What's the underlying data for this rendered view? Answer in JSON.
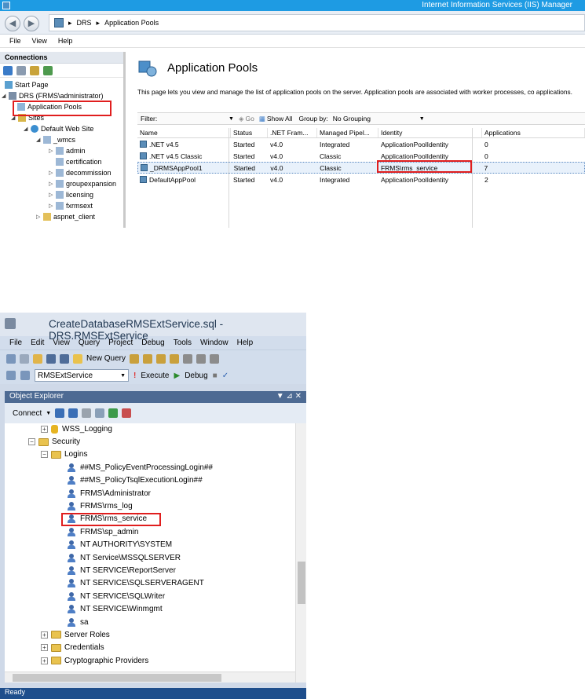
{
  "iis": {
    "window_title": "Internet Information Services (IIS) Manager",
    "breadcrumb": [
      "DRS",
      "Application Pools"
    ],
    "menu": [
      "File",
      "View",
      "Help"
    ],
    "connections_label": "Connections",
    "tree": {
      "start_page": "Start Page",
      "server": "DRS (FRMS\\administrator)",
      "app_pools": "Application Pools",
      "sites": "Sites",
      "default_site": "Default Web Site",
      "children": [
        "_wmcs",
        "admin",
        "certification",
        "decommission",
        "groupexpansion",
        "licensing",
        "fxrmsext",
        "aspnet_client"
      ]
    },
    "page_title": "Application Pools",
    "description": "This page lets you view and manage the list of application pools on the server. Application pools are associated with worker processes, co applications.",
    "filter": {
      "label": "Filter:",
      "go": "Go",
      "show_all": "Show All",
      "group_by_label": "Group by:",
      "group_by_value": "No Grouping"
    },
    "columns": [
      "Name",
      "Status",
      ".NET Fram...",
      "Managed Pipel...",
      "Identity",
      "Applications"
    ],
    "rows": [
      {
        "name": ".NET v4.5",
        "status": "Started",
        "net": "v4.0",
        "pipeline": "Integrated",
        "identity": "ApplicationPoolIdentity",
        "apps": "0"
      },
      {
        "name": ".NET v4.5 Classic",
        "status": "Started",
        "net": "v4.0",
        "pipeline": "Classic",
        "identity": "ApplicationPoolIdentity",
        "apps": "0"
      },
      {
        "name": "_DRMSAppPool1",
        "status": "Started",
        "net": "v4.0",
        "pipeline": "Classic",
        "identity": "FRMS\\rms_service",
        "apps": "7"
      },
      {
        "name": "DefaultAppPool",
        "status": "Started",
        "net": "v4.0",
        "pipeline": "Integrated",
        "identity": "ApplicationPoolIdentity",
        "apps": "2"
      }
    ]
  },
  "ssms": {
    "window_title": "CreateDatabaseRMSExtService.sql - DRS.RMSExtService",
    "menu": [
      "File",
      "Edit",
      "View",
      "Query",
      "Project",
      "Debug",
      "Tools",
      "Window",
      "Help"
    ],
    "new_query": "New Query",
    "database": "RMSExtService",
    "execute": "Execute",
    "debug": "Debug",
    "object_explorer": "Object Explorer",
    "connect": "Connect",
    "tree": {
      "wss_logging": "WSS_Logging",
      "security": "Security",
      "logins": "Logins",
      "login_items": [
        "##MS_PolicyEventProcessingLogin##",
        "##MS_PolicyTsqlExecutionLogin##",
        "FRMS\\Administrator",
        "FRMS\\rms_log",
        "FRMS\\rms_service",
        "FRMS\\sp_admin",
        "NT AUTHORITY\\SYSTEM",
        "NT Service\\MSSQLSERVER",
        "NT SERVICE\\ReportServer",
        "NT SERVICE\\SQLSERVERAGENT",
        "NT SERVICE\\SQLWriter",
        "NT SERVICE\\Winmgmt",
        "sa"
      ],
      "server_roles": "Server Roles",
      "credentials": "Credentials",
      "crypto": "Cryptographic Providers"
    },
    "status": "Ready"
  },
  "colors": {
    "iis_title": "#1e9be3",
    "highlight_box": "#e01e1e",
    "ssms_oe_header": "#4d6a93",
    "ssms_status": "#1e4e8c"
  }
}
